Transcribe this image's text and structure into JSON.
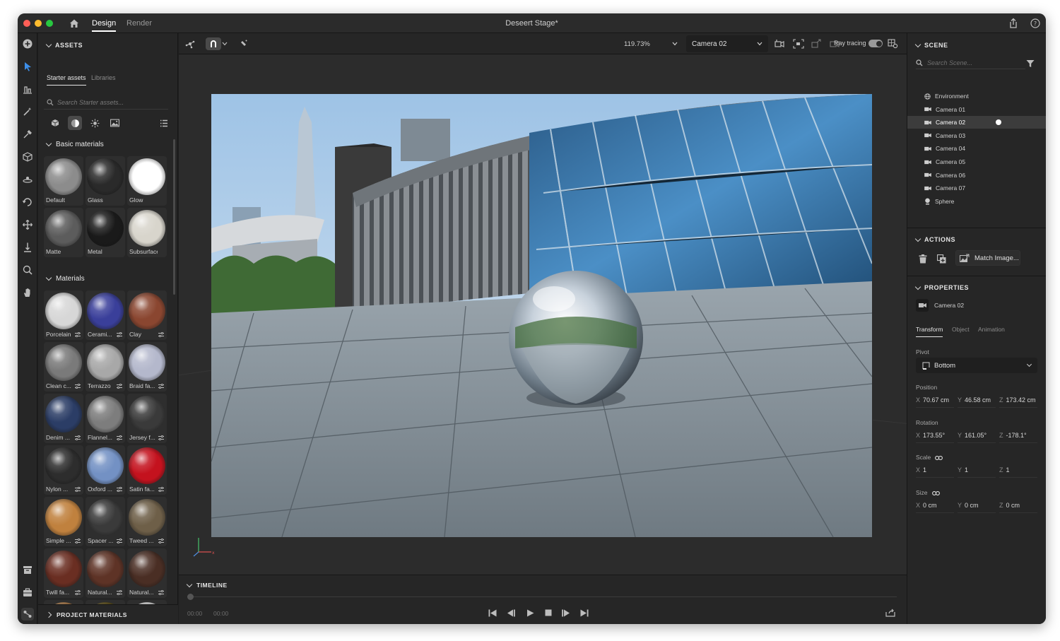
{
  "window": {
    "title": "Deseert Stage*",
    "tabs": [
      {
        "label": "Design"
      },
      {
        "label": "Render"
      }
    ]
  },
  "assets": {
    "section_title": "ASSETS",
    "subtabs": [
      {
        "label": "Starter assets"
      },
      {
        "label": "Libraries"
      }
    ],
    "search_placeholder": "Search Starter assets...",
    "basic_group": "Basic materials",
    "basic_items": [
      {
        "label": "Default",
        "color": "#8c8c8c"
      },
      {
        "label": "Glass",
        "color": "#2a2a2a"
      },
      {
        "label": "Glow",
        "color": "#ffffff"
      },
      {
        "label": "Matte",
        "color": "#5c5c5c"
      },
      {
        "label": "Metal",
        "color": "#1a1a1a"
      },
      {
        "label": "Subsurface",
        "color": "#d8d5cc"
      }
    ],
    "materials_group": "Materials",
    "material_items": [
      {
        "label": "Porcelain",
        "color": "#d7d7d7"
      },
      {
        "label": "Cerami...",
        "color": "#3a3f9a"
      },
      {
        "label": "Clay",
        "color": "#8a4630"
      },
      {
        "label": "Clean c...",
        "color": "#7a7a7a"
      },
      {
        "label": "Terrazzo",
        "color": "#a8a8a8"
      },
      {
        "label": "Braid fa...",
        "color": "#b4b8cc"
      },
      {
        "label": "Denim ...",
        "color": "#2b3d66"
      },
      {
        "label": "Flannel...",
        "color": "#7d7d7d"
      },
      {
        "label": "Jersey f...",
        "color": "#3a3a3a"
      },
      {
        "label": "Nylon ...",
        "color": "#2d2d2d"
      },
      {
        "label": "Oxford ...",
        "color": "#7391c4"
      },
      {
        "label": "Satin fa...",
        "color": "#c4121e"
      },
      {
        "label": "Simple ...",
        "color": "#c0813e"
      },
      {
        "label": "Spacer ...",
        "color": "#3a3a3a"
      },
      {
        "label": "Tweed ...",
        "color": "#6e5f48"
      },
      {
        "label": "Twill fa...",
        "color": "#6a2e22"
      },
      {
        "label": "Natural...",
        "color": "#5e3326"
      },
      {
        "label": "Natural...",
        "color": "#4a2e24"
      },
      {
        "label": "",
        "color": "#b07a44"
      },
      {
        "label": "",
        "color": "#5a4a10"
      },
      {
        "label": "",
        "color": "#e4e4e4"
      }
    ],
    "project_materials": "PROJECT MATERIALS"
  },
  "toolbar": {
    "zoom": "119.73%",
    "camera": "Camera 02",
    "ray_tracing_label": "Ray tracing",
    "ray_tracing_on": true
  },
  "timeline": {
    "title": "TIMELINE",
    "time_current": "00:00",
    "time_total": "00:00"
  },
  "scene": {
    "title": "SCENE",
    "search_placeholder": "Search Scene...",
    "items": [
      {
        "label": "Environment",
        "icon": "globe-icon"
      },
      {
        "label": "Camera 01",
        "icon": "camera-icon"
      },
      {
        "label": "Camera 02",
        "icon": "camera-icon",
        "selected": true
      },
      {
        "label": "Camera 03",
        "icon": "camera-icon"
      },
      {
        "label": "Camera 04",
        "icon": "camera-icon"
      },
      {
        "label": "Camera 05",
        "icon": "camera-icon"
      },
      {
        "label": "Camera 06",
        "icon": "camera-icon"
      },
      {
        "label": "Camera 07",
        "icon": "camera-icon"
      },
      {
        "label": "Sphere",
        "icon": "sphere-object-icon"
      }
    ]
  },
  "actions": {
    "title": "ACTIONS",
    "match_image_label": "Match Image..."
  },
  "properties": {
    "title": "PROPERTIES",
    "object_name": "Camera 02",
    "tabs": [
      {
        "label": "Transform"
      },
      {
        "label": "Object"
      },
      {
        "label": "Animation"
      }
    ],
    "pivot_label": "Pivot",
    "pivot_value": "Bottom",
    "position_label": "Position",
    "position": {
      "x": "70.67 cm",
      "y": "46.58 cm",
      "z": "173.42 cm"
    },
    "rotation_label": "Rotation",
    "rotation": {
      "x": "173.55°",
      "y": "161.05°",
      "z": "-178.1°"
    },
    "scale_label": "Scale",
    "scale": {
      "x": "1",
      "y": "1",
      "z": "1"
    },
    "size_label": "Size",
    "size": {
      "x": "0 cm",
      "y": "0 cm",
      "z": "0 cm"
    },
    "axis_x": "X",
    "axis_y": "Y",
    "axis_z": "Z"
  },
  "colors": {
    "panel_bg": "#262626",
    "viewport_bg": "#2c2c2c",
    "selected_row": "#3c3c3c",
    "accent_tool": "#3d8ee8"
  }
}
